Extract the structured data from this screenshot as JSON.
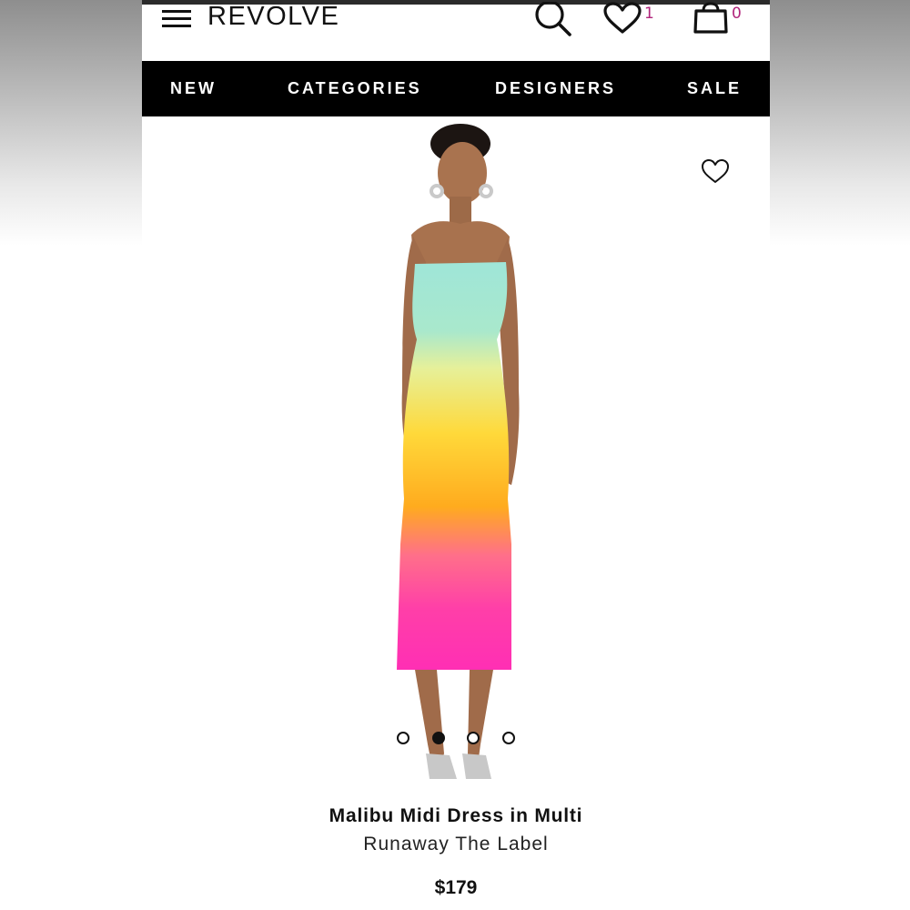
{
  "header": {
    "logo": "REVOLVE",
    "wishlist_count": "1",
    "bag_count": "0",
    "count_color": "#b1257c"
  },
  "nav": {
    "items": [
      "NEW",
      "CATEGORIES",
      "DESIGNERS",
      "SALE"
    ]
  },
  "gallery": {
    "total_images": 4,
    "active_index": 1
  },
  "product": {
    "title": "Malibu Midi Dress in Multi",
    "brand": "Runaway The Label",
    "price": "$179"
  },
  "icons": {
    "menu": "hamburger-menu-icon",
    "search": "search-icon",
    "wishlist": "heart-icon",
    "bag": "shopping-bag-icon",
    "favorite": "heart-outline-icon"
  }
}
